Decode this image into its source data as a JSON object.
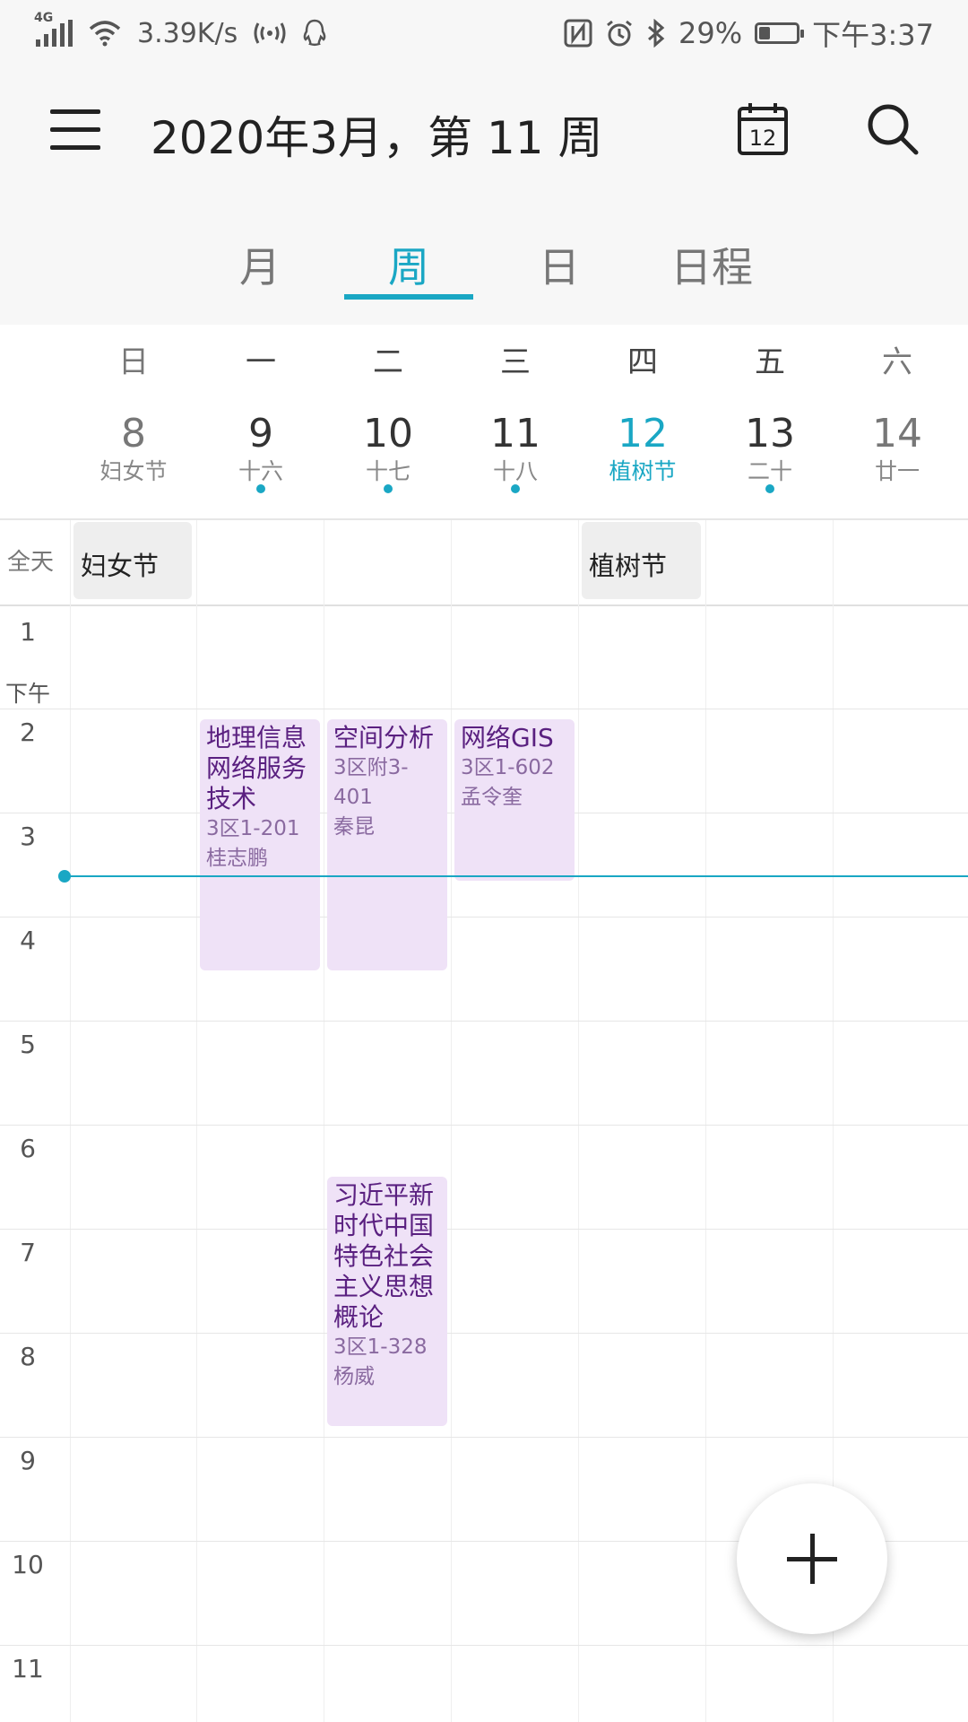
{
  "status_bar": {
    "network_type": "4G",
    "speed": "3.39K/s",
    "battery": "29%",
    "battery_level": 0.29,
    "time": "下午3:37",
    "icons": [
      "signal-icon",
      "wifi-icon",
      "hotspot-icon",
      "qq-icon",
      "nfc-icon",
      "alarm-icon",
      "bluetooth-icon",
      "battery-icon"
    ]
  },
  "app_bar": {
    "title": "2020年3月，第 11 周",
    "today_icon_day": "12",
    "icons": [
      "menu-icon",
      "calendar-today-icon",
      "search-icon"
    ]
  },
  "tabs": [
    {
      "label": "月",
      "active": false
    },
    {
      "label": "周",
      "active": true
    },
    {
      "label": "日",
      "active": false
    },
    {
      "label": "日程",
      "active": false
    }
  ],
  "days": [
    {
      "dow": "日",
      "date": "8",
      "lunar": "妇女节",
      "has_events": false,
      "today": false
    },
    {
      "dow": "一",
      "date": "9",
      "lunar": "十六",
      "has_events": true,
      "today": false
    },
    {
      "dow": "二",
      "date": "10",
      "lunar": "十七",
      "has_events": true,
      "today": false
    },
    {
      "dow": "三",
      "date": "11",
      "lunar": "十八",
      "has_events": true,
      "today": false
    },
    {
      "dow": "四",
      "date": "12",
      "lunar": "植树节",
      "has_events": false,
      "today": true
    },
    {
      "dow": "五",
      "date": "13",
      "lunar": "二十",
      "has_events": true,
      "today": false
    },
    {
      "dow": "六",
      "date": "14",
      "lunar": "廿一",
      "has_events": false,
      "today": false
    }
  ],
  "all_day": {
    "label": "全天",
    "events": [
      {
        "day_index": 0,
        "title": "妇女节"
      },
      {
        "day_index": 4,
        "title": "植树节"
      }
    ]
  },
  "hour_labels": [
    "1",
    "2",
    "3",
    "4",
    "5",
    "6",
    "7",
    "8",
    "9",
    "10",
    "11"
  ],
  "pm_label": "下午",
  "events": [
    {
      "day_index": 1,
      "start": "14:00",
      "end": "16:30",
      "title": "地理信息网络服务技术",
      "location": "3区1-201",
      "teacher": "桂志鹏"
    },
    {
      "day_index": 2,
      "start": "14:00",
      "end": "16:30",
      "title": "空间分析",
      "location": "3区附3-401",
      "teacher": "秦昆"
    },
    {
      "day_index": 3,
      "start": "14:00",
      "end": "15:40",
      "title": "网络GIS",
      "location": "3区1-602",
      "teacher": "孟令奎"
    },
    {
      "day_index": 2,
      "start": "18:30",
      "end": "20:55",
      "title": "习近平新时代中国特色社会主义思想概论",
      "location": "3区1-328",
      "teacher": "杨威"
    }
  ],
  "now_time": "15:37",
  "colors": {
    "accent": "#1aa7c4",
    "event_bg": "#efe2f7",
    "event_title": "#5a2080",
    "event_sub": "#8a6aa0",
    "all_day_bg": "#eeeeee"
  },
  "fab": {
    "icon": "plus-icon"
  }
}
